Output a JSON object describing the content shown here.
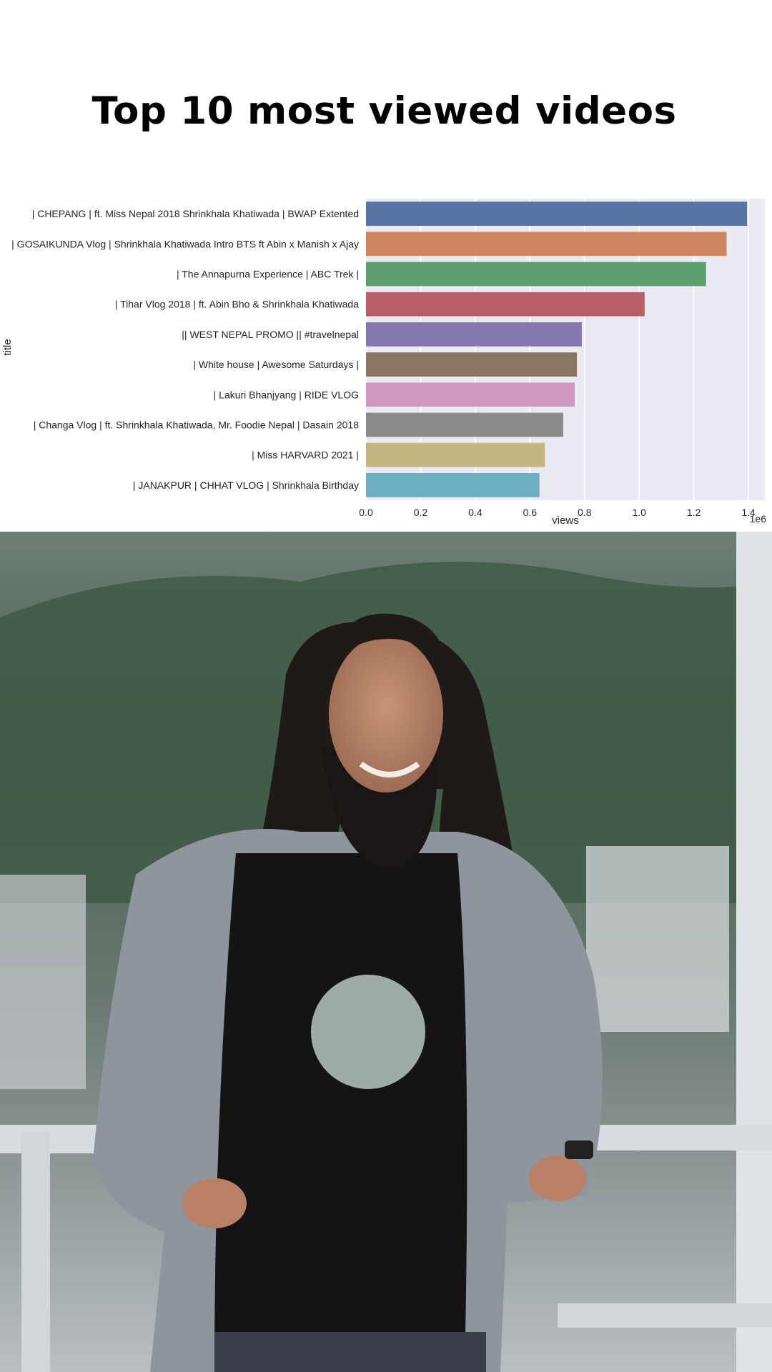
{
  "title": "Top 10 most viewed videos",
  "chart_data": {
    "type": "bar",
    "orientation": "horizontal",
    "categories": [
      "| CHEPANG |  ft. Miss Nepal 2018 Shrinkhala Khatiwada | BWAP Extented",
      "| GOSAIKUNDA Vlog | Shrinkhala Khatiwada Intro BTS ft Abin x Manish x Ajay",
      "| The Annapurna Experience | ABC Trek |",
      "| Tihar Vlog 2018 | ft. Abin Bho & Shrinkhala Khatiwada",
      "|| WEST NEPAL PROMO ||  #travelnepal",
      "| White house | Awesome Saturdays |",
      "| Lakuri Bhanjyang | RIDE VLOG",
      "| Changa Vlog | ft. Shrinkhala Khatiwada, Mr. Foodie Nepal | Dasain 2018",
      "| Miss HARVARD 2021 |",
      "| JANAKPUR | CHHAT VLOG | Shrinkhala Birthday"
    ],
    "values": [
      1395000,
      1320000,
      1245000,
      1020000,
      790000,
      772000,
      764000,
      722000,
      655000,
      635000
    ],
    "colors": [
      "#5874a6",
      "#d0875f",
      "#5ea06d",
      "#b95e66",
      "#8677ad",
      "#8a7563",
      "#d197c3",
      "#8b8b8b",
      "#c5b581",
      "#6daec1"
    ],
    "xlabel": "views",
    "ylabel": "title",
    "x_ticks": [
      0,
      0.2,
      0.4,
      0.6,
      0.8,
      1.0,
      1.2,
      1.4
    ],
    "x_tick_labels": [
      "0.0",
      "0.2",
      "0.4",
      "0.6",
      "0.8",
      "1.0",
      "1.2",
      "1.4"
    ],
    "x_offset_label": "1e6",
    "xlim": [
      0,
      1460000
    ],
    "grid": true,
    "background": "#eaeaf2"
  },
  "photo": {
    "icon": "person-photo",
    "colors": {
      "mountain": "#3f5a46",
      "sky": "#6f7f77",
      "shirt": "#141414",
      "jacket": "#8e959d",
      "rail": "#d9dde2"
    }
  }
}
